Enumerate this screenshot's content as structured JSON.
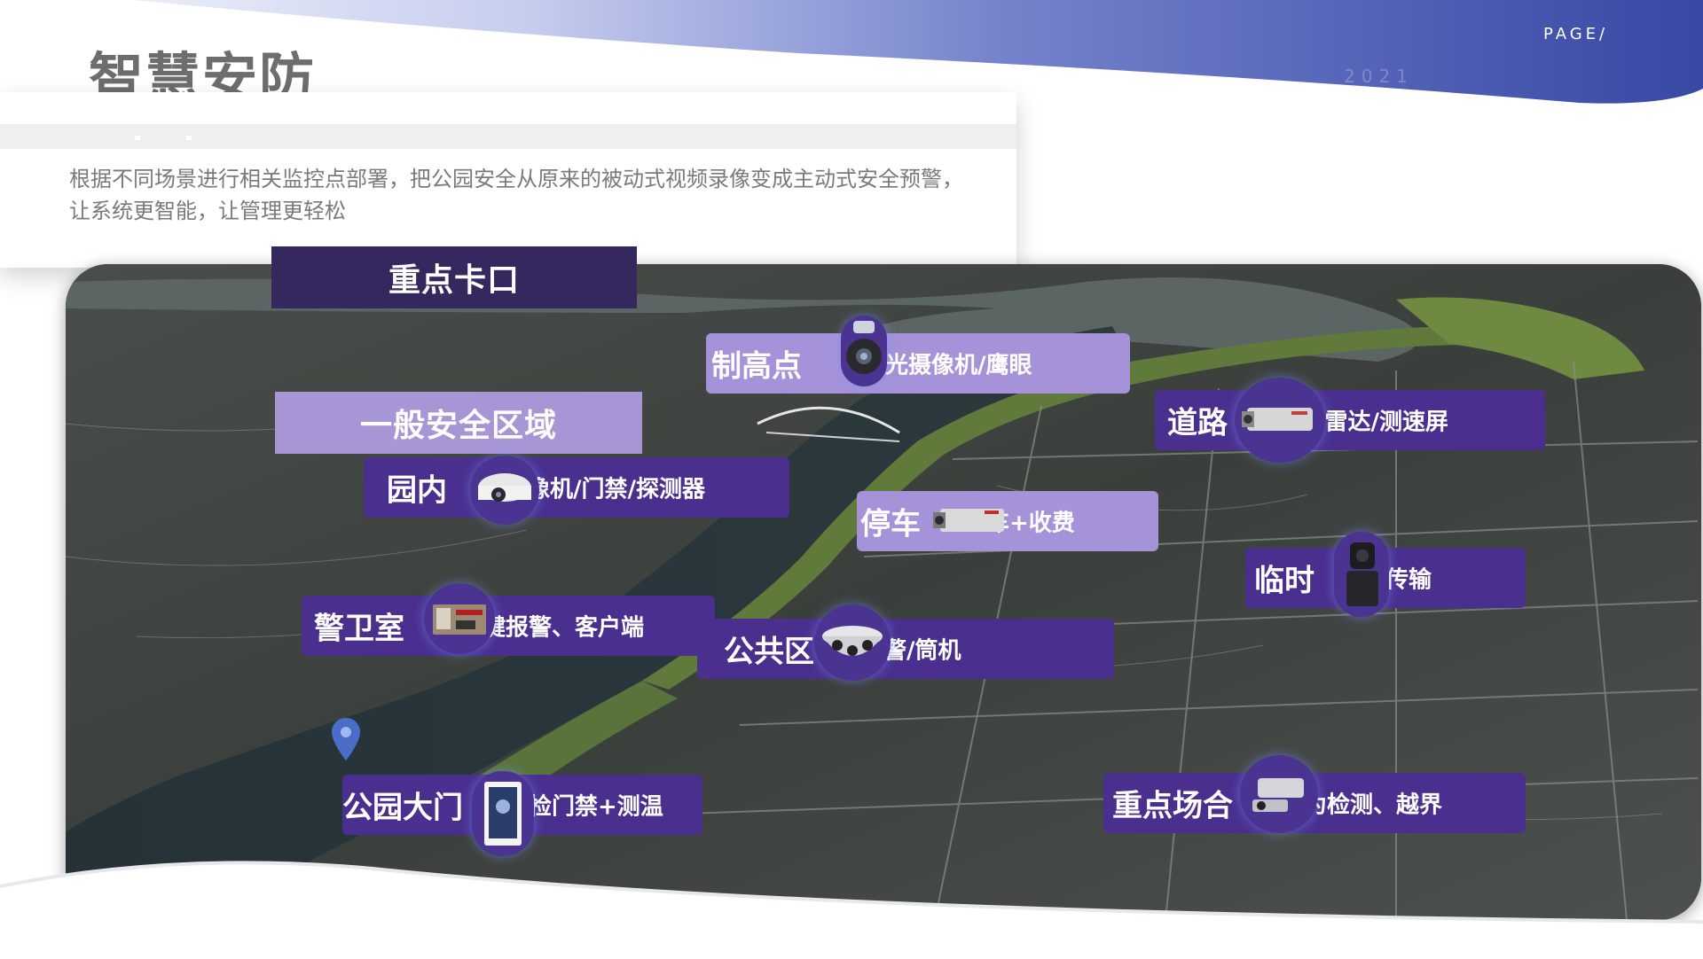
{
  "header": {
    "title": "智慧安防",
    "page_label": "PAGE/",
    "year": "2021",
    "description": "根据不同场景进行相关监控点部署，把公园安全从原来的被动式视频录像变成主动式安全预警，让系统更智能，让管理更轻松"
  },
  "zones": {
    "key_checkpoint": "重点卡口",
    "general_area": "一般安全区域"
  },
  "tags": {
    "lookout": {
      "title": "制高点",
      "desc": "光摄像机/鹰眼"
    },
    "road": {
      "title": "道路",
      "desc": "/雷达/测速屏"
    },
    "park_inside": {
      "title": "园内",
      "desc": "像机/门禁/探测器"
    },
    "parking": {
      "title": "停车",
      "desc": "车+收费"
    },
    "temporary": {
      "title": "临时",
      "desc": "传输"
    },
    "guard_room": {
      "title": "警卫室",
      "desc": "键报警、客户端"
    },
    "public_area": {
      "title": "公共区",
      "desc": "警/筒机"
    },
    "park_gate": {
      "title": "公园大门",
      "desc": "检门禁+测温"
    },
    "key_venue": {
      "title": "重点场合",
      "desc": "为检测、越界"
    }
  },
  "colors": {
    "dark_purple": "#4a2f8f",
    "light_purple": "#a592d8",
    "zone_dark": "#35285e",
    "band_blue": "#4b5bb0"
  }
}
